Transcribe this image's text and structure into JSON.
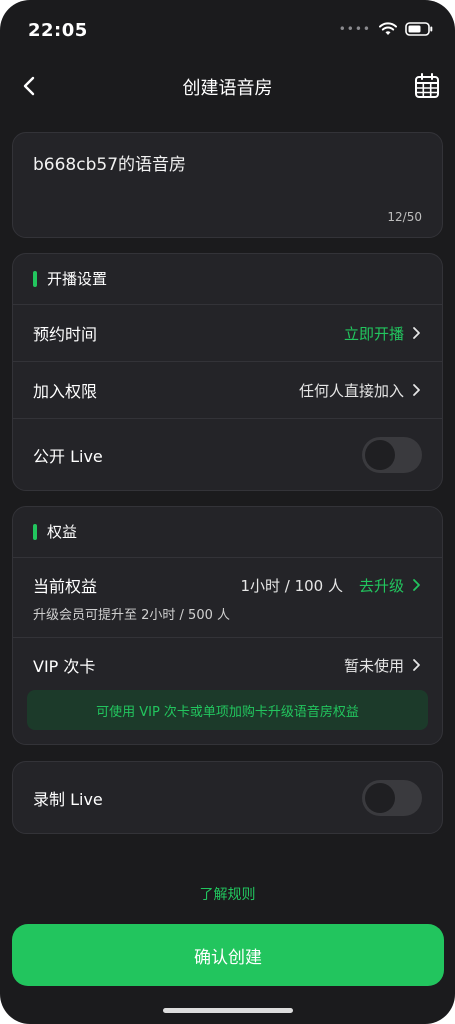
{
  "status_bar": {
    "time": "22:05",
    "signal_dots": "••••",
    "icons": [
      "wifi-icon",
      "battery-icon"
    ]
  },
  "nav": {
    "title": "创建语音房",
    "back_icon": "back-chevron-icon",
    "calendar_icon": "calendar-icon"
  },
  "room": {
    "title": "b668cb57的语音房",
    "char_count": "12/50"
  },
  "broadcast_settings": {
    "heading": "开播设置",
    "schedule": {
      "label": "预约时间",
      "value": "立即开播"
    },
    "permission": {
      "label": "加入权限",
      "value": "任何人直接加入"
    },
    "public_live": {
      "label": "公开 Live",
      "enabled": false
    }
  },
  "benefits": {
    "heading": "权益",
    "current": {
      "label": "当前权益",
      "value": "1小时 / 100 人",
      "upgrade": "去升级",
      "note": "升级会员可提升至 2小时 / 500 人"
    },
    "vip_card": {
      "label": "VIP 次卡",
      "value": "暂未使用",
      "tip": "可使用 VIP 次卡或单项加购卡升级语音房权益"
    }
  },
  "record_live": {
    "label": "录制 Live",
    "enabled": false
  },
  "footer": {
    "rules_link": "了解规则",
    "confirm_button": "确认创建"
  },
  "colors": {
    "background": "#1b1b1d",
    "card": "#242428",
    "accent_green": "#22c55e"
  }
}
